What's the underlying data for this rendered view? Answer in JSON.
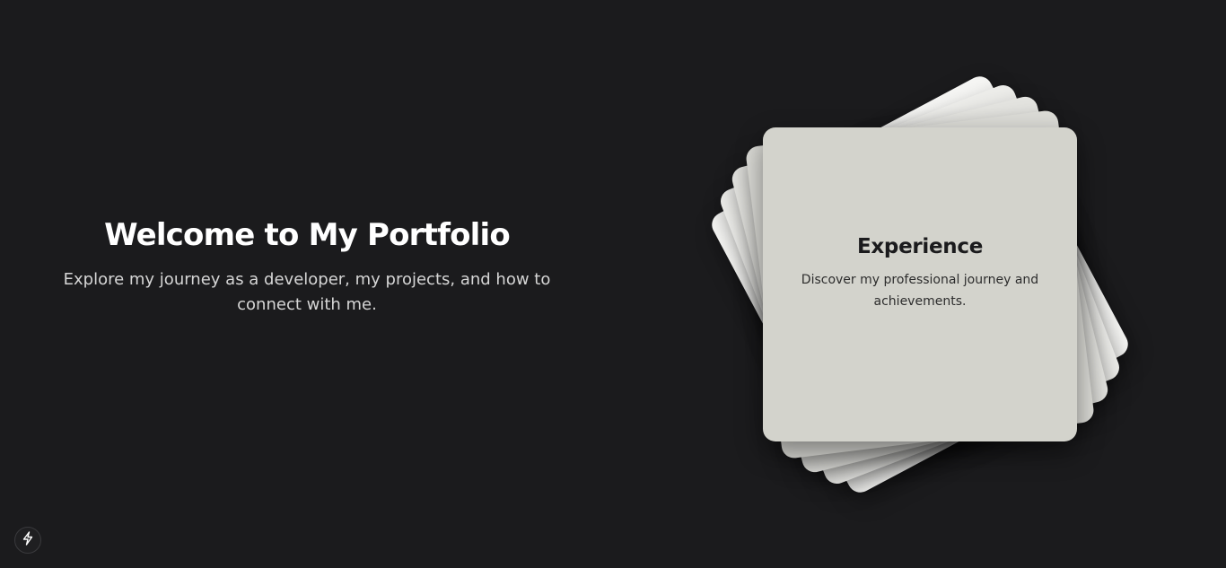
{
  "hero": {
    "title": "Welcome to My Portfolio",
    "subtitle": "Explore my journey as a developer, my projects, and how to connect with me."
  },
  "cards": {
    "active": {
      "title": "Experience",
      "description": "Discover my professional journey and achievements."
    }
  },
  "dev_indicator": {
    "icon": "lightning-bolt-icon"
  },
  "colors": {
    "background": "#1b1b1d",
    "card_front": "#d3d3cc",
    "card_back": "#f6f6f4",
    "title_text": "#ffffff"
  }
}
